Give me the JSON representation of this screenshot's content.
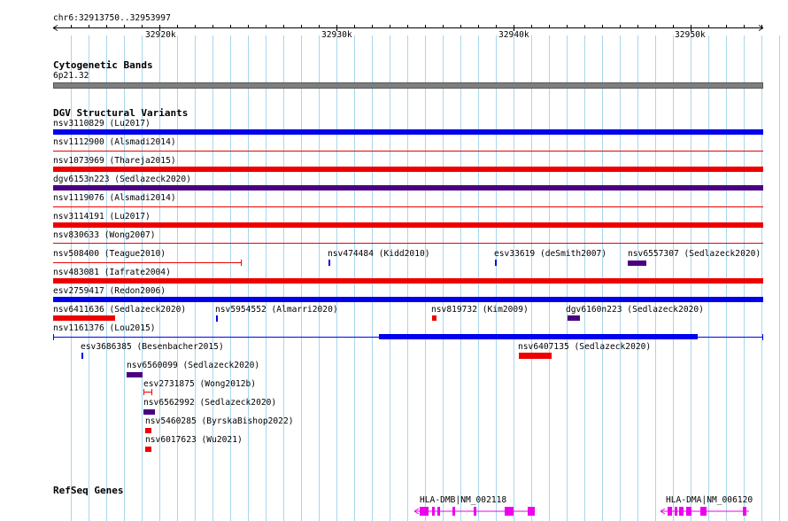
{
  "ruler": {
    "location": "chr6:32913750..32953997",
    "ticks": [
      "32920k",
      "32930k",
      "32940k",
      "32950k"
    ]
  },
  "cytoband": {
    "title": "Cytogenetic Bands",
    "band": "6p21.32"
  },
  "dgv": {
    "title": "DGV Structural Variants",
    "variants": [
      {
        "label": "nsv3110829 (Lu2017)",
        "color": "#0000ee"
      },
      {
        "label": "nsv1112900 (Alsmadi2014)",
        "color": "#ee0000"
      },
      {
        "label": "nsv1073969 (Thareja2015)",
        "color": "#ee0000"
      },
      {
        "label": "dgv6153n223 (Sedlazeck2020)",
        "color": "#4b0082"
      },
      {
        "label": "nsv1119076 (Alsmadi2014)",
        "color": "#ee0000"
      },
      {
        "label": "nsv3114191 (Lu2017)",
        "color": "#ee0000"
      },
      {
        "label": "nsv830633 (Wong2007)",
        "color": "#ee0000"
      },
      {
        "label": "nsv508400 (Teague2010)",
        "color": "#ee0000"
      },
      {
        "label": "nsv474484 (Kidd2010)",
        "color": "#0000ee"
      },
      {
        "label": "esv33619 (deSmith2007)",
        "color": "#0000ee"
      },
      {
        "label": "nsv6557307 (Sedlazeck2020)",
        "color": "#4b0082"
      },
      {
        "label": "nsv483081 (Iafrate2004)",
        "color": "#ee0000"
      },
      {
        "label": "esv2759417 (Redon2006)",
        "color": "#0000ee"
      },
      {
        "label": "nsv6411636 (Sedlazeck2020)",
        "color": "#ee0000"
      },
      {
        "label": "nsv5954552 (Almarri2020)",
        "color": "#0000ee"
      },
      {
        "label": "nsv819732 (Kim2009)",
        "color": "#ee0000"
      },
      {
        "label": "dgv6160n223 (Sedlazeck2020)",
        "color": "#4b0082"
      },
      {
        "label": "nsv1161376 (Lou2015)",
        "color": "#0000ee"
      },
      {
        "label": "esv3686385 (Besenbacher2015)",
        "color": "#0000ee"
      },
      {
        "label": "nsv6407135 (Sedlazeck2020)",
        "color": "#ee0000"
      },
      {
        "label": "nsv6560099 (Sedlazeck2020)",
        "color": "#4b0082"
      },
      {
        "label": "esv2731875 (Wong2012b)",
        "color": "#ee0000"
      },
      {
        "label": "nsv6562992 (Sedlazeck2020)",
        "color": "#4b0082"
      },
      {
        "label": "nsv5460285 (ByrskaBishop2022)",
        "color": "#ee0000"
      },
      {
        "label": "nsv6017623 (Wu2021)",
        "color": "#ee0000"
      }
    ]
  },
  "refseq": {
    "title": "RefSeq Genes",
    "genes": [
      {
        "label": "HLA-DMB|NM_002118",
        "color": "#ee00ee"
      },
      {
        "label": "HLA-DMA|NM_006120",
        "color": "#ee00ee"
      }
    ]
  }
}
